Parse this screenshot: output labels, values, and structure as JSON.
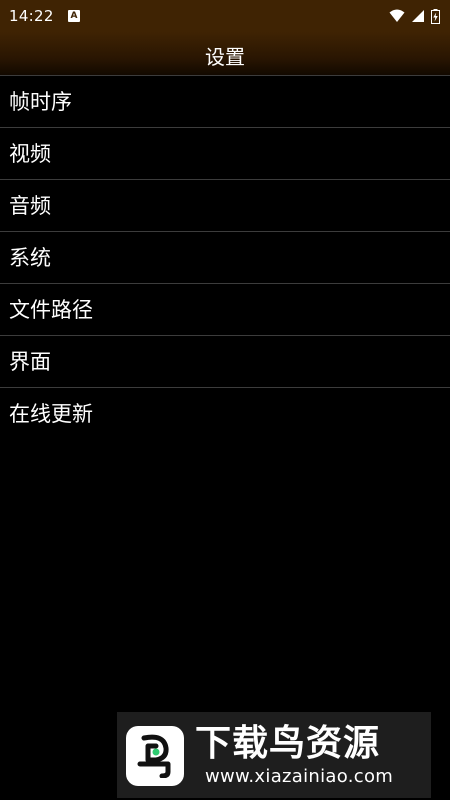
{
  "status_bar": {
    "time": "14:22",
    "notification_icon": "A",
    "icons": [
      "wifi-icon",
      "signal-icon",
      "battery-charging-icon"
    ]
  },
  "app_bar": {
    "title": "设置"
  },
  "menu": {
    "items": [
      {
        "label": "帧时序"
      },
      {
        "label": "视频"
      },
      {
        "label": "音频"
      },
      {
        "label": "系统"
      },
      {
        "label": "文件路径"
      },
      {
        "label": "界面"
      },
      {
        "label": "在线更新"
      }
    ]
  },
  "watermark": {
    "title": "下载鸟资源",
    "url": "www.xiazainiao.com"
  },
  "colors": {
    "status_bar_bg": "#3f2303",
    "background": "#000000",
    "divider": "#3c3c3c",
    "text": "#ffffff",
    "watermark_bg": "#1e1e1e",
    "logo_accent": "#2ecc71"
  }
}
